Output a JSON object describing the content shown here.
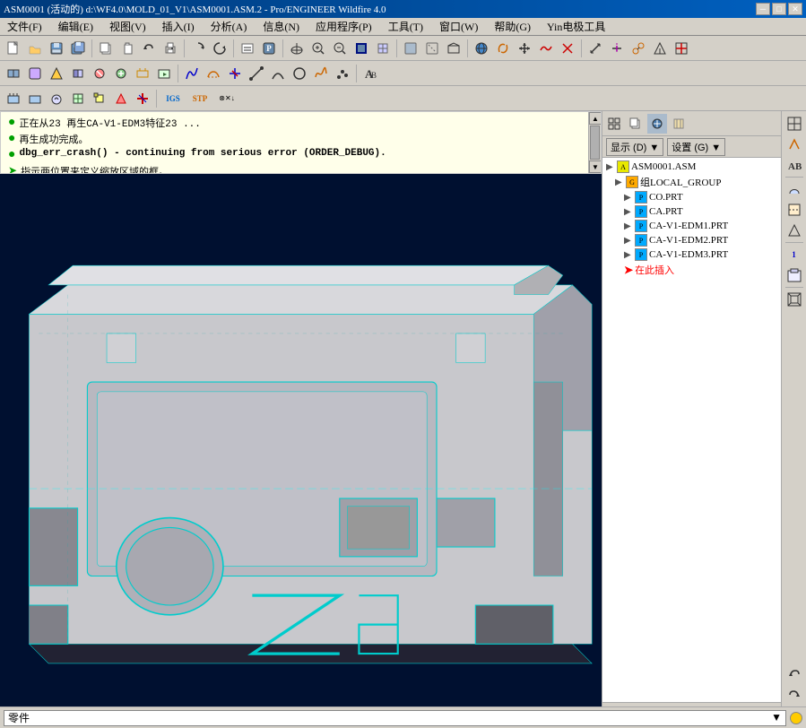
{
  "titleBar": {
    "text": "ASM0001 (活动的) d:\\WF4.0\\MOLD_01_V1\\ASM0001.ASM.2 - Pro/ENGINEER Wildfire 4.0",
    "minimize": "─",
    "maximize": "□",
    "close": "✕"
  },
  "menuBar": {
    "items": [
      "文件(F)",
      "编辑(E)",
      "视图(V)",
      "插入(I)",
      "分析(A)",
      "信息(N)",
      "应用程序(P)",
      "工具(T)",
      "窗口(W)",
      "帮助(G)",
      "Yin电极工具"
    ]
  },
  "messageArea": {
    "lines": [
      {
        "type": "bullet",
        "text": "正在从23 再生CA-V1-EDM3特征23 ..."
      },
      {
        "type": "bullet",
        "text": "再生成功完成。"
      },
      {
        "type": "bullet",
        "text": "dbg_err_crash() - continuing from serious error (ORDER_DEBUG)."
      },
      {
        "type": "arrow",
        "text": "指示两位置来定义缩放区域的框。"
      }
    ]
  },
  "rightPanel": {
    "displayLabel": "显示 (D) ▼",
    "settingsLabel": "设置 (G) ▼",
    "tree": [
      {
        "level": 0,
        "expand": false,
        "type": "asm",
        "label": "ASM0001.ASM"
      },
      {
        "level": 1,
        "expand": false,
        "type": "group",
        "label": "组LOCAL_GROUP"
      },
      {
        "level": 2,
        "expand": false,
        "type": "prt",
        "label": "CO.PRT"
      },
      {
        "level": 2,
        "expand": false,
        "type": "prt",
        "label": "CA.PRT"
      },
      {
        "level": 2,
        "expand": false,
        "type": "prt",
        "label": "CA-V1-EDM1.PRT"
      },
      {
        "level": 2,
        "expand": false,
        "type": "prt",
        "label": "CA-V1-EDM2.PRT"
      },
      {
        "level": 2,
        "expand": false,
        "type": "prt",
        "label": "CA-V1-EDM3.PRT"
      },
      {
        "level": 2,
        "expand": false,
        "type": "insert",
        "label": "在此插入"
      }
    ]
  },
  "statusBar": {
    "partLabel": "零件"
  },
  "icons": {
    "undo": "↩",
    "redo": "↪"
  }
}
